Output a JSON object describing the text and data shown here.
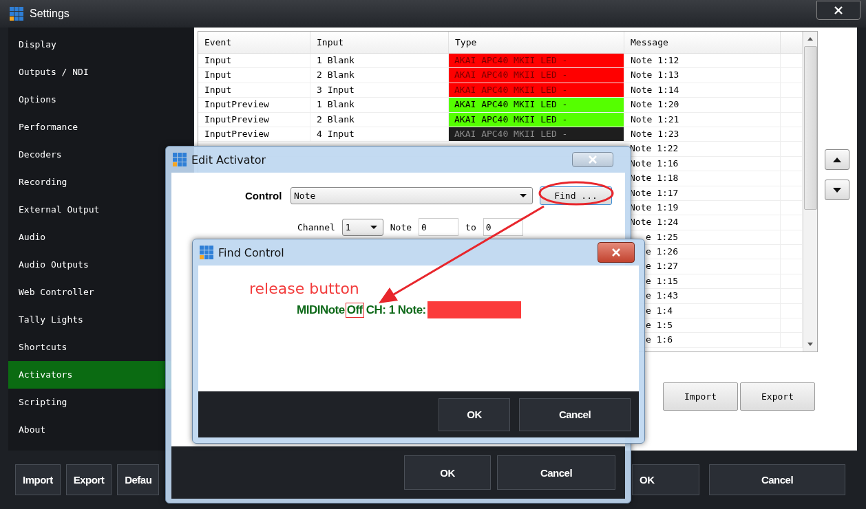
{
  "settings_window": {
    "title": "Settings",
    "sidebar": {
      "items": [
        {
          "label": "Display",
          "selected": false
        },
        {
          "label": "Outputs / NDI",
          "selected": false
        },
        {
          "label": "Options",
          "selected": false
        },
        {
          "label": "Performance",
          "selected": false
        },
        {
          "label": "Decoders",
          "selected": false
        },
        {
          "label": "Recording",
          "selected": false
        },
        {
          "label": "External Output",
          "selected": false
        },
        {
          "label": "Audio",
          "selected": false
        },
        {
          "label": "Audio Outputs",
          "selected": false
        },
        {
          "label": "Web Controller",
          "selected": false
        },
        {
          "label": "Tally Lights",
          "selected": false
        },
        {
          "label": "Shortcuts",
          "selected": false
        },
        {
          "label": "Activators",
          "selected": true
        },
        {
          "label": "Scripting",
          "selected": false
        },
        {
          "label": "About",
          "selected": false
        }
      ]
    },
    "table": {
      "columns": [
        "Event",
        "Input",
        "Type",
        "Message"
      ],
      "rows": [
        {
          "event": "Input",
          "input": "1 Blank",
          "type": "AKAI APC40 MKII LED -",
          "color": "#ff0000",
          "message": "Note 1:12"
        },
        {
          "event": "Input",
          "input": "2 Blank",
          "type": "AKAI APC40 MKII LED -",
          "color": "#ff0000",
          "message": "Note 1:13"
        },
        {
          "event": "Input",
          "input": "3 Input",
          "type": "AKAI APC40 MKII LED -",
          "color": "#ff0000",
          "message": "Note 1:14"
        },
        {
          "event": "InputPreview",
          "input": "1 Blank",
          "type": "AKAI APC40 MKII LED -",
          "color": "#55ff00",
          "message": "Note 1:20"
        },
        {
          "event": "InputPreview",
          "input": "2 Blank",
          "type": "AKAI APC40 MKII LED -",
          "color": "#55ff00",
          "message": "Note 1:21"
        },
        {
          "event": "InputPreview",
          "input": "4 Input",
          "type": "AKAI APC40 MKII LED -",
          "color": "#1e1e1e",
          "message": "Note 1:23"
        }
      ],
      "messages_beside_edit_window": [
        "Note 1:22",
        "Note 1:16",
        "Note 1:18",
        "Note 1:17",
        "Note 1:19",
        "Note 1:24"
      ],
      "messages_beside_find_window": [
        "e 1:25",
        "e 1:26",
        "e 1:27",
        "e 1:15",
        "e 1:43",
        "e 1:4",
        "e 1:5",
        "e 1:6"
      ]
    },
    "list_buttons": [
      "Import",
      "Export"
    ],
    "footer_left_buttons": [
      "Import",
      "Export",
      "Defau"
    ],
    "footer_right_buttons": [
      "OK",
      "Cancel"
    ]
  },
  "edit_activator": {
    "title": "Edit Activator",
    "control_label": "Control",
    "control_value": "Note",
    "find_button": "Find ...",
    "channel_label": "Channel",
    "channel_value": "1",
    "note_label": "Note",
    "note_from": "0",
    "to_label": "to",
    "note_to": "0",
    "buttons": [
      "OK",
      "Cancel"
    ]
  },
  "find_control": {
    "title": "Find Control",
    "annotation": "release button",
    "message_prefix": "MIDINote",
    "message_highlight": "Off",
    "message_suffix": "CH: 1 Note:",
    "buttons": [
      "OK",
      "Cancel"
    ]
  }
}
